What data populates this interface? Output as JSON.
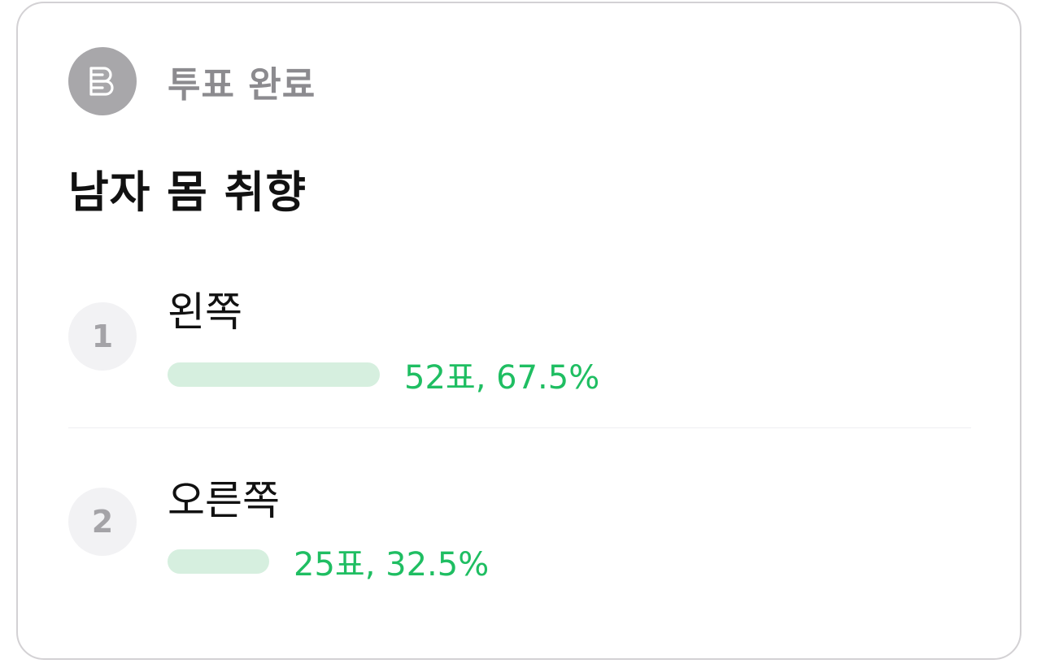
{
  "status": {
    "icon": "vote-icon",
    "label": "투표 완료"
  },
  "poll": {
    "title": "남자 몸 취향",
    "accent_color": "#1fbe62",
    "bar_color": "#d6efdf",
    "options": [
      {
        "rank": "1",
        "label": "왼쪽",
        "result": "52표, 67.5%",
        "votes": 52,
        "percent": 67.5
      },
      {
        "rank": "2",
        "label": "오른쪽",
        "result": "25표, 32.5%",
        "votes": 25,
        "percent": 32.5
      }
    ]
  }
}
